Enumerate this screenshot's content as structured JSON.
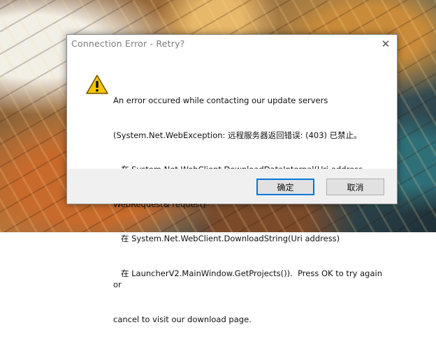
{
  "dialog": {
    "title": "Connection Error - Retry?",
    "close_glyph": "✕",
    "icon": "warning-icon",
    "message_lines": [
      "An error occured while contacting our update servers",
      "(System.Net.WebException: 远程服务器返回错误: (403) 已禁止。",
      "   在 System.Net.WebClient.DownloadDataInternal(Uri address,",
      "WebRequest& request)",
      "   在 System.Net.WebClient.DownloadString(Uri address)",
      "   在 LauncherV2.MainWindow.GetProjects()).  Press OK to try again or",
      "cancel to visit our download page."
    ],
    "buttons": {
      "ok_label": "确定",
      "cancel_label": "取消"
    },
    "colors": {
      "warning_fill": "#f5c400",
      "warning_border": "#6b5200",
      "focus_border": "#0078d7"
    }
  }
}
